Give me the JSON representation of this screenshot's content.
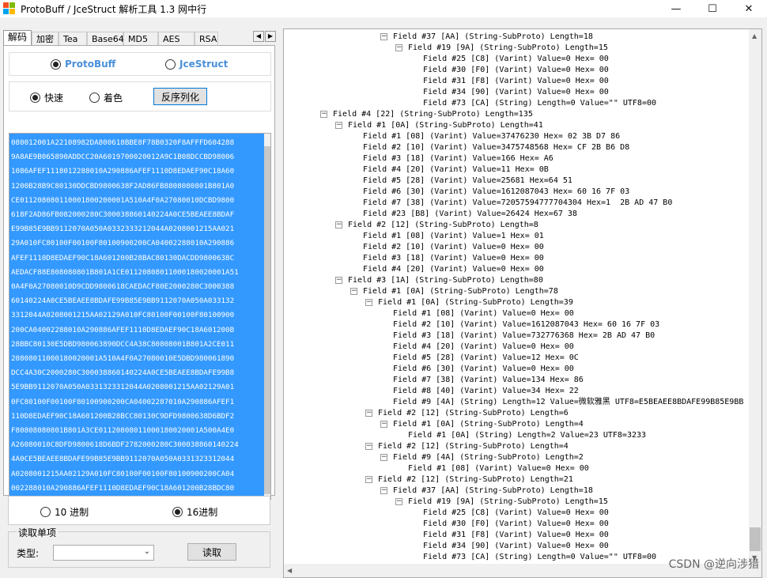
{
  "window": {
    "title": "ProtoBuff / JceStruct 解析工具 1.3  网中行",
    "logo_colors": [
      "#f25022",
      "#7fba00",
      "#00a4ef",
      "#ffb900"
    ],
    "minimize": "—",
    "maximize": "☐",
    "close": "✕"
  },
  "tabs": [
    "解码",
    "加密",
    "Tea",
    "Base64",
    "MD5",
    "AES",
    "RSA"
  ],
  "tab_arrows": {
    "left": "◀",
    "right": "▶"
  },
  "format": {
    "protobuf": "ProtoBuff",
    "jce": "JceStruct"
  },
  "mode": {
    "fast": "快速",
    "color": "着色",
    "deserialize_button": "反序列化"
  },
  "hex_text": "080012001A22108982DA800618BBE8F78B0320F8AFFFD604288\n9A8AE9B065890ADDCC20A6019700020012A9C1B08DCCBD98006\n1086AFEF1118012288010A290886AFEF1110D8EDAEF90C18A60\n1200B28B9C80130DDCBD9800638F2AD86FB8808080801B801A0\nCE011208080110001800200001A510A4F0A27080010DCBD9800\n618F2AD86FB082000280C300038860140224A0CE5BEAEE8BDAF\nE99B85E9BB9112070A050A0332333212044A0208001215AA021\n29A010FC80100F00100F80100900200CA04002288010A290886\nAFEF1110D8EDAEF90C18A601200B28BAC80130DACDD9800638C\nAEDACF88E808080801B801A1CE01120808011000180020001A51\n0A4F0A27080010D9CDD9800618CAEDACF80E2000280C3000388\n60140224A0CE5BEAEE8BDAFE99B85E9BB9112070A050A033132\n3312044A0208001215AA02129A010FC80100F00100F80100900\n200CA04002288010A290886AFEF1110D8EDAEF90C18A601200B\n28BBC80130E5DBD980063890DCC4A38C80808001B801A2CE011\n20808011000180020001A510A4F0A27080010E5DBD980061890\nDCC4A30C2000280C300038860140224A0CE5BEAEE8BDAFE99B8\n5E9BB9112070A050A0331323312044A0208001215AA02129A01\n0FC80100F00100F80100900200CA04002287010A290886AFEF1\n110D8EDAEF90C18A601200B28BCC80130C9DFD9800638D6BDF2\nF80808080801B801A3CE01120808011000180020001A500A4E0\nA26080010C8DFD9800618D6BDF2782000280C300038860140224\n4A0CE5BEAEE8BDAFE99B85E9BB9112070A050A0331323312044\nA0208001215AA02129A010FC80100F00100F80100900200CA04\n002288010A290886AFEF1110D8EDAEF90C18A601200B28BDC80\n130DDDFD9800638D197C0958F80808001B801A4CE0112080801\n1000180020001A510A4F0A27080010DCDFD9800618D197C0950\nF2000280C300038860140224A0CE5BEAEE8BDAFE99B85E9BB91\n12070A050A0331323312044A0208001215AA02129A010FC8010",
  "radix": {
    "dec": "10 进制",
    "hex": "16进制"
  },
  "single_read": {
    "group_label": "读取单项",
    "type_label": "类型:",
    "type_value": "",
    "read_button": "读取"
  },
  "tree_rows": [
    {
      "d": 4,
      "t": "Field #37 [AA] (String-SubProto) Length=18",
      "e": "−"
    },
    {
      "d": 5,
      "t": "Field #19 [9A] (String-SubProto) Length=15",
      "e": "−"
    },
    {
      "d": 6,
      "t": "Field #25 [C8] (Varint) Value=0 Hex= 00"
    },
    {
      "d": 6,
      "t": "Field #30 [F0] (Varint) Value=0 Hex= 00"
    },
    {
      "d": 6,
      "t": "Field #31 [F8] (Varint) Value=0 Hex= 00"
    },
    {
      "d": 6,
      "t": "Field #34 [90] (Varint) Value=0 Hex= 00"
    },
    {
      "d": 6,
      "t": "Field #73 [CA] (String) Length=0 Value=\"\" UTF8=00"
    },
    {
      "d": 0,
      "t": "Field #4 [22] (String-SubProto) Length=135",
      "e": "−"
    },
    {
      "d": 1,
      "t": "Field #1 [0A] (String-SubProto) Length=41",
      "e": "−"
    },
    {
      "d": 2,
      "t": "Field #1 [08] (Varint) Value=37476230 Hex= 02 3B D7 86"
    },
    {
      "d": 2,
      "t": "Field #2 [10] (Varint) Value=3475748568 Hex= CF 2B B6 D8"
    },
    {
      "d": 2,
      "t": "Field #3 [18] (Varint) Value=166 Hex= A6"
    },
    {
      "d": 2,
      "t": "Field #4 [20] (Varint) Value=11 Hex= 0B"
    },
    {
      "d": 2,
      "t": "Field #5 [28] (Varint) Value=25681 Hex=64 51"
    },
    {
      "d": 2,
      "t": "Field #6 [30] (Varint) Value=1612087043 Hex= 60 16 7F 03"
    },
    {
      "d": 2,
      "t": "Field #7 [38] (Varint) Value=72057594777704304 Hex=1  2B AD 47 B0"
    },
    {
      "d": 2,
      "t": "Field #23 [B8] (Varint) Value=26424 Hex=67 38"
    },
    {
      "d": 1,
      "t": "Field #2 [12] (String-SubProto) Length=8",
      "e": "−"
    },
    {
      "d": 2,
      "t": "Field #1 [08] (Varint) Value=1 Hex= 01"
    },
    {
      "d": 2,
      "t": "Field #2 [10] (Varint) Value=0 Hex= 00"
    },
    {
      "d": 2,
      "t": "Field #3 [18] (Varint) Value=0 Hex= 00"
    },
    {
      "d": 2,
      "t": "Field #4 [20] (Varint) Value=0 Hex= 00"
    },
    {
      "d": 1,
      "t": "Field #3 [1A] (String-SubProto) Length=80",
      "e": "−"
    },
    {
      "d": 2,
      "t": "Field #1 [0A] (String-SubProto) Length=78",
      "e": "−"
    },
    {
      "d": 3,
      "t": "Field #1 [0A] (String-SubProto) Length=39",
      "e": "−"
    },
    {
      "d": 4,
      "t": "Field #1 [08] (Varint) Value=0 Hex= 00"
    },
    {
      "d": 4,
      "t": "Field #2 [10] (Varint) Value=1612087043 Hex= 60 16 7F 03"
    },
    {
      "d": 4,
      "t": "Field #3 [18] (Varint) Value=732776368 Hex= 2B AD 47 B0"
    },
    {
      "d": 4,
      "t": "Field #4 [20] (Varint) Value=0 Hex= 00"
    },
    {
      "d": 4,
      "t": "Field #5 [28] (Varint) Value=12 Hex= 0C"
    },
    {
      "d": 4,
      "t": "Field #6 [30] (Varint) Value=0 Hex= 00"
    },
    {
      "d": 4,
      "t": "Field #7 [38] (Varint) Value=134 Hex= 86"
    },
    {
      "d": 4,
      "t": "Field #8 [40] (Varint) Value=34 Hex= 22"
    },
    {
      "d": 4,
      "t": "Field #9 [4A] (String) Length=12 Value=微软雅黑 UTF8=E5BEAEE8BDAFE99B85E9BB"
    },
    {
      "d": 3,
      "t": "Field #2 [12] (String-SubProto) Length=6",
      "e": "−"
    },
    {
      "d": 4,
      "t": "Field #1 [0A] (String-SubProto) Length=4",
      "e": "−"
    },
    {
      "d": 5,
      "t": "Field #1 [0A] (String) Length=2 Value=23 UTF8=3233"
    },
    {
      "d": 3,
      "t": "Field #2 [12] (String-SubProto) Length=4",
      "e": "−"
    },
    {
      "d": 4,
      "t": "Field #9 [4A] (String-SubProto) Length=2",
      "e": "−"
    },
    {
      "d": 5,
      "t": "Field #1 [08] (Varint) Value=0 Hex= 00"
    },
    {
      "d": 3,
      "t": "Field #2 [12] (String-SubProto) Length=21",
      "e": "−"
    },
    {
      "d": 4,
      "t": "Field #37 [AA] (String-SubProto) Length=18",
      "e": "−"
    },
    {
      "d": 5,
      "t": "Field #19 [9A] (String-SubProto) Length=15",
      "e": "−"
    },
    {
      "d": 6,
      "t": "Field #25 [C8] (Varint) Value=0 Hex= 00"
    },
    {
      "d": 6,
      "t": "Field #30 [F0] (Varint) Value=0 Hex= 00"
    },
    {
      "d": 6,
      "t": "Field #31 [F8] (Varint) Value=0 Hex= 00"
    },
    {
      "d": 6,
      "t": "Field #34 [90] (Varint) Value=0 Hex= 00"
    },
    {
      "d": 6,
      "t": "Field #73 [CA] (String) Length=0 Value=\"\" UTF8=00"
    }
  ],
  "watermark": "CSDN @逆向涉猎"
}
